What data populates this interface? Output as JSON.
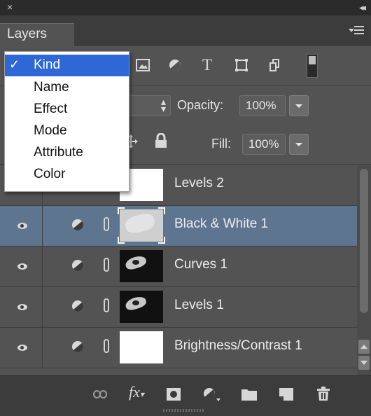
{
  "window": {
    "close_glyph": "×",
    "collapse_glyph": "◂◂",
    "tab_label": "Layers"
  },
  "filter": {
    "kind_menu": [
      {
        "label": "Kind",
        "checked": true
      },
      {
        "label": "Name",
        "checked": false
      },
      {
        "label": "Effect",
        "checked": false
      },
      {
        "label": "Mode",
        "checked": false
      },
      {
        "label": "Attribute",
        "checked": false
      },
      {
        "label": "Color",
        "checked": false
      }
    ],
    "check_glyph": "✓",
    "filter_type_icons": [
      "pixel-layer-filter-icon",
      "adjustment-layer-filter-icon",
      "type-layer-filter-icon",
      "shape-layer-filter-icon",
      "smart-object-filter-icon"
    ],
    "type_glyph": "T"
  },
  "blend": {
    "opacity_label": "Opacity:",
    "opacity_value": "100%"
  },
  "lock": {
    "fill_label": "Fill:",
    "fill_value": "100%"
  },
  "layers": [
    {
      "name": "Levels 2",
      "visible": false,
      "thumb": "white",
      "selected": false
    },
    {
      "name": "Black & White 1",
      "visible": true,
      "thumb": "gray",
      "selected": true
    },
    {
      "name": "Curves 1",
      "visible": true,
      "thumb": "dark",
      "selected": false
    },
    {
      "name": "Levels 1",
      "visible": true,
      "thumb": "dark",
      "selected": false
    },
    {
      "name": "Brightness/Contrast 1",
      "visible": true,
      "thumb": "white",
      "selected": false
    }
  ],
  "footer_icons": [
    "link-layers-icon",
    "fx-icon",
    "add-mask-icon",
    "new-adjustment-layer-icon",
    "new-group-icon",
    "new-layer-icon",
    "trash-icon"
  ],
  "footer": {
    "fx_label": "fx"
  },
  "colors": {
    "panel": "#535353",
    "selected_row": "#5e7590",
    "menu_highlight": "#2d68d6"
  }
}
